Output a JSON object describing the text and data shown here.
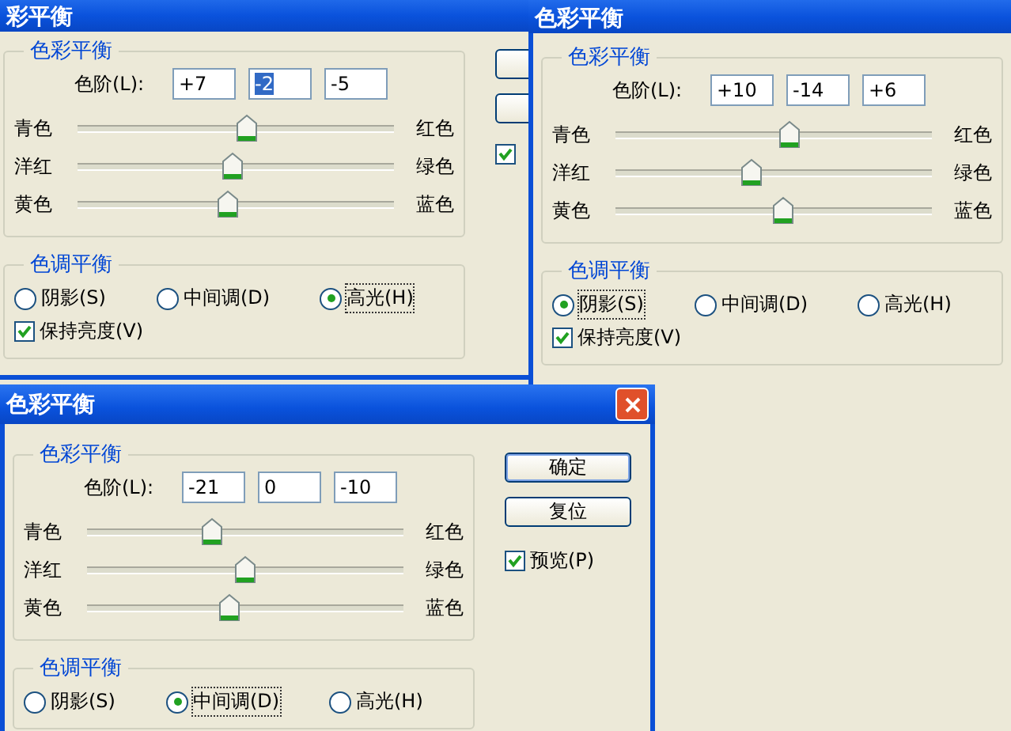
{
  "dialogs": [
    {
      "title": "彩平衡",
      "color_balance": {
        "legend": "色彩平衡",
        "levels_label": "色阶(L):",
        "levels": [
          {
            "value": "+7",
            "selected": false
          },
          {
            "value": "-2",
            "selected": true
          },
          {
            "value": "-5",
            "selected": false
          }
        ],
        "sliders": [
          {
            "left": "青色",
            "right": "红色",
            "level": 0.535
          },
          {
            "left": "洋红",
            "right": "绿色",
            "level": 0.49
          },
          {
            "left": "黄色",
            "right": "蓝色",
            "level": 0.475
          }
        ]
      },
      "tone_balance": {
        "legend": "色调平衡",
        "options": [
          {
            "label": "阴影(S)",
            "selected": false
          },
          {
            "label": "中间调(D)",
            "selected": false
          },
          {
            "label": "高光(H)",
            "selected": true
          }
        ],
        "preserve": {
          "label": "保持亮度(V)",
          "checked": true
        }
      },
      "side": {
        "buttons": [
          {
            "kind": "blank"
          },
          {
            "kind": "blank"
          }
        ],
        "preview": {
          "checked": true
        }
      }
    },
    {
      "title": "色彩平衡",
      "color_balance": {
        "legend": "色彩平衡",
        "levels_label": "色阶(L):",
        "levels": [
          {
            "value": "+10",
            "selected": false
          },
          {
            "value": "-14",
            "selected": false
          },
          {
            "value": "+6",
            "selected": false
          }
        ],
        "sliders": [
          {
            "left": "青色",
            "right": "红色",
            "level": 0.55
          },
          {
            "left": "洋红",
            "right": "绿色",
            "level": 0.43
          },
          {
            "left": "黄色",
            "right": "蓝色",
            "level": 0.53
          }
        ]
      },
      "tone_balance": {
        "legend": "色调平衡",
        "options": [
          {
            "label": "阴影(S)",
            "selected": true
          },
          {
            "label": "中间调(D)",
            "selected": false
          },
          {
            "label": "高光(H)",
            "selected": false
          }
        ],
        "preserve": {
          "label": "保持亮度(V)",
          "checked": true
        }
      }
    },
    {
      "title": "色彩平衡",
      "close_button": true,
      "color_balance": {
        "legend": "色彩平衡",
        "levels_label": "色阶(L):",
        "levels": [
          {
            "value": "-21",
            "selected": false
          },
          {
            "value": "0",
            "selected": false
          },
          {
            "value": "-10",
            "selected": false
          }
        ],
        "sliders": [
          {
            "left": "青色",
            "right": "红色",
            "level": 0.395
          },
          {
            "left": "洋红",
            "right": "绿色",
            "level": 0.5
          },
          {
            "left": "黄色",
            "right": "蓝色",
            "level": 0.45
          }
        ]
      },
      "tone_balance": {
        "legend": "色调平衡",
        "options": [
          {
            "label": "阴影(S)",
            "selected": false
          },
          {
            "label": "中间调(D)",
            "selected": true
          },
          {
            "label": "高光(H)",
            "selected": false
          }
        ]
      },
      "side": {
        "buttons": [
          {
            "kind": "default",
            "label": "确定"
          },
          {
            "kind": "normal",
            "label": "复位"
          }
        ],
        "preview": {
          "label": "预览(P)",
          "checked": true
        }
      }
    }
  ]
}
